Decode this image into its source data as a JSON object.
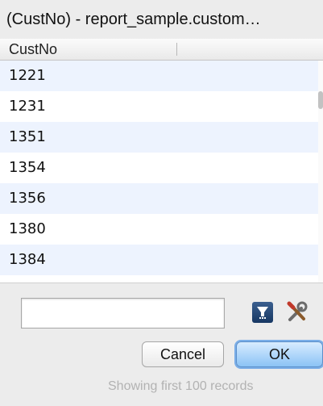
{
  "window": {
    "title": "(CustNo) - report_sample.custom…"
  },
  "table": {
    "column_header": "CustNo",
    "rows": [
      "1221",
      "1231",
      "1351",
      "1354",
      "1356",
      "1380",
      "1384"
    ]
  },
  "search": {
    "value": "",
    "placeholder": ""
  },
  "icons": {
    "filter": "filter-icon",
    "tools": "tools-icon"
  },
  "buttons": {
    "cancel_label": "Cancel",
    "ok_label": "OK"
  },
  "status_text": "Showing first 100 records",
  "colors": {
    "alt_row": "#edf3fe",
    "ok_button": "#8bc3f5"
  }
}
